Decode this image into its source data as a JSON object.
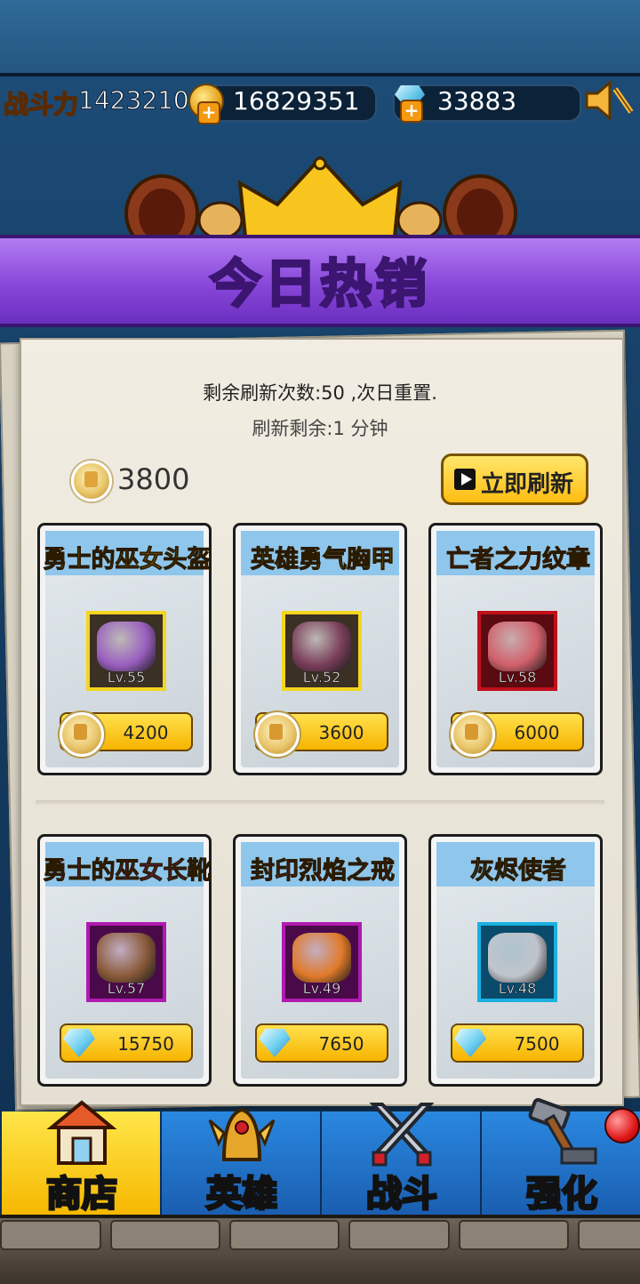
{
  "top_bar": {
    "power_label": "战斗力",
    "power_value": "1423210",
    "gold_value": "16829351",
    "gem_value": "33883",
    "gold_icon": "gold-coin-plus-icon",
    "gem_icon": "diamond-plus-icon",
    "sound_icon": "speaker-muted-icon"
  },
  "banner": {
    "title": "今日热销"
  },
  "shop": {
    "refresh_count": "剩余刷新次数:50 ,次日重置.",
    "refresh_time": "刷新剩余:1 分钟",
    "currency_value": "3800",
    "refresh_button": "立即刷新"
  },
  "items": [
    {
      "name": "勇士的巫女头盔",
      "level": "Lv.55",
      "price": "4200",
      "currency": "medal",
      "name_color": "#f2c21a",
      "frame_color": "#f4d51f",
      "icon": "witch-hat-icon"
    },
    {
      "name": "英雄勇气胸甲",
      "level": "Lv.52",
      "price": "3600",
      "currency": "medal",
      "name_color": "#f2c21a",
      "frame_color": "#f4d51f",
      "icon": "chest-armor-icon"
    },
    {
      "name": "亡者之力纹章",
      "level": "Lv.58",
      "price": "6000",
      "currency": "medal",
      "name_color": "#e0101a",
      "frame_color": "#c0101a",
      "icon": "emblem-icon"
    },
    {
      "name": "勇士的巫女长靴",
      "level": "Lv.57",
      "price": "15750",
      "currency": "gem",
      "name_color": "#e030d0",
      "frame_color": "#b01ab0",
      "icon": "boots-icon"
    },
    {
      "name": "封印烈焰之戒",
      "level": "Lv.49",
      "price": "7650",
      "currency": "gem",
      "name_color": "#e030d0",
      "frame_color": "#b01ab0",
      "icon": "fire-ring-icon"
    },
    {
      "name": "灰烬使者",
      "level": "Lv.48",
      "price": "7500",
      "currency": "gem",
      "name_color": "#1ac0ea",
      "frame_color": "#1ab0e0",
      "icon": "sword-icon"
    }
  ],
  "nav": [
    {
      "label": "商店",
      "icon": "shop-house-icon"
    },
    {
      "label": "英雄",
      "icon": "winged-helmet-icon"
    },
    {
      "label": "战斗",
      "icon": "crossed-swords-icon"
    },
    {
      "label": "强化",
      "icon": "forge-hammer-icon"
    }
  ]
}
